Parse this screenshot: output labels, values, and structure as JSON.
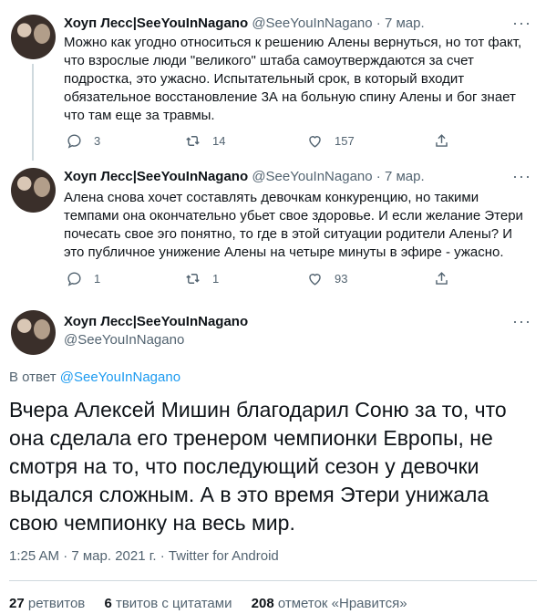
{
  "tweets": [
    {
      "name": "Хоуп Лесс|SeeYouInNagano",
      "handle": "@SeeYouInNagano",
      "separator": "·",
      "date": "7 мар.",
      "text": "Можно как угодно относиться к решению Алены вернуться, но тот факт, что взрослые люди \"великого\" штаба самоутверждаются за счет подростка, это ужасно. Испытательный срок, в который входит обязательное восстановление 3А на больную спину Алены и бог знает что там еще за травмы.",
      "replies": "3",
      "retweets": "14",
      "likes": "157"
    },
    {
      "name": "Хоуп Лесс|SeeYouInNagano",
      "handle": "@SeeYouInNagano",
      "separator": "·",
      "date": "7 мар.",
      "text": "Алена снова хочет составлять девочкам конкуренцию, но такими темпами она окончательно убьет свое здоровье. И если желание Этери почесать свое эго понятно, то где в этой ситуации родители Алены? И это публичное унижение Алены на четыре минуты в эфире - ужасно.",
      "replies": "1",
      "retweets": "1",
      "likes": "93"
    }
  ],
  "main": {
    "name": "Хоуп Лесс|SeeYouInNagano",
    "handle": "@SeeYouInNagano",
    "reply_prefix": "В ответ",
    "reply_handle": "@SeeYouInNagano",
    "text": "Вчера Алексей Мишин благодарил Соню за то, что она сделала его тренером чемпионки Европы, не смотря на то, что последующий сезон у девочки выдался сложным. А в это время Этери унижала свою чемпионку на весь мир.",
    "meta": "1:25 AM · 7 мар. 2021 г. · Twitter for Android",
    "retweets_count": "27",
    "retweets_label": "ретвитов",
    "quotes_count": "6",
    "quotes_label": "твитов с цитатами",
    "likes_count": "208",
    "likes_label": "отметок «Нравится»"
  },
  "icons": {
    "more": "more-dots-icon",
    "reply": "reply-bubble-icon",
    "retweet": "retweet-arrows-icon",
    "like": "heart-icon",
    "share": "share-upload-icon"
  },
  "colors": {
    "text": "#0f1419",
    "secondary": "#536471",
    "link": "#1d9bf0",
    "border": "#cfd9de"
  }
}
